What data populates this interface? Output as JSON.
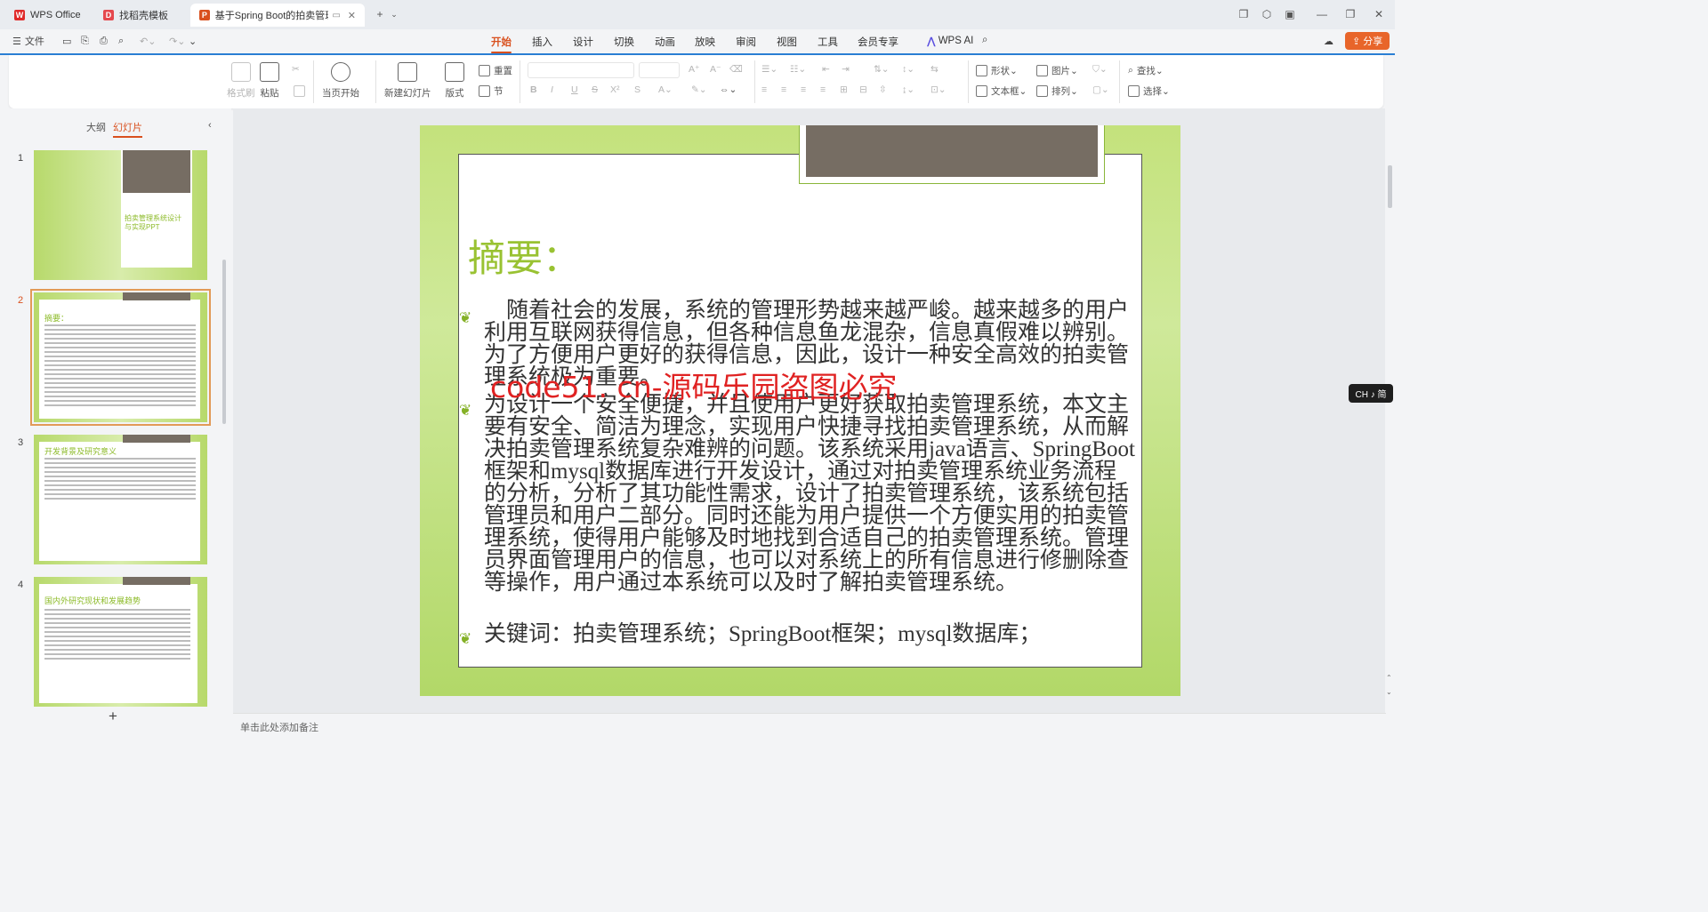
{
  "tabs": [
    {
      "label": "WPS Office",
      "logo": "W",
      "logo_color": "#e02a2a"
    },
    {
      "label": "找稻壳模板",
      "logo": "D",
      "logo_color": "#e5484d"
    },
    {
      "label": "基于Spring Boot的拍卖管理",
      "logo": "P",
      "logo_color": "#d9501e"
    }
  ],
  "menu": {
    "file_label": "文件",
    "tabs": [
      "开始",
      "插入",
      "设计",
      "切换",
      "动画",
      "放映",
      "审阅",
      "视图",
      "工具",
      "会员专享"
    ],
    "active_tab": "开始",
    "wps_ai": "WPS AI",
    "share": "分享"
  },
  "ribbon": {
    "format_painter": "格式刷",
    "paste": "粘贴",
    "current_start": "当页开始",
    "new_slide": "新建幻灯片",
    "layout": "版式",
    "reset": "重置",
    "section": "节",
    "font_size_a_up": "A⁺",
    "font_size_a_down": "A⁻",
    "bold": "B",
    "italic": "I",
    "underline": "U",
    "strike": "S",
    "superscript": "X²",
    "shape": "形状",
    "picture": "图片",
    "textbox": "文本框",
    "arrange": "排列",
    "find": "查找",
    "select": "选择"
  },
  "left_panel": {
    "tabs": [
      "大纲",
      "幻灯片"
    ],
    "active_tab": "幻灯片",
    "add_label": "+",
    "slides": [
      {
        "num": "1",
        "title": "拍卖管理系统设计与实现PPT"
      },
      {
        "num": "2",
        "title": "摘要："
      },
      {
        "num": "3",
        "title": "开发背景及研究意义"
      },
      {
        "num": "4",
        "title": "国内外研究现状和发展趋势"
      }
    ]
  },
  "slide": {
    "title": "摘要：",
    "bullets": [
      "　随着社会的发展，系统的管理形势越来越严峻。越来越多的用户利用互联网获得信息，但各种信息鱼龙混杂，信息真假难以辨别。为了方便用户更好的获得信息，因此，设计一种安全高效的拍卖管理系统极为重要。",
      "为设计一个安全便捷，并且使用户更好获取拍卖管理系统，本文主要有安全、简洁为理念，实现用户快捷寻找拍卖管理系统，从而解决拍卖管理系统复杂难辨的问题。该系统采用java语言、SpringBoot框架和mysql数据库进行开发设计，通过对拍卖管理系统业务流程的分析，分析了其功能性需求，设计了拍卖管理系统，该系统包括管理员和用户二部分。同时还能为用户提供一个方便实用的拍卖管理系统，使得用户能够及时地找到合适自己的拍卖管理系统。管理员界面管理用户的信息，也可以对系统上的所有信息进行修删除查等操作，用户通过本系统可以及时了解拍卖管理系统。",
      "关键词：拍卖管理系统；SpringBoot框架；mysql数据库；"
    ],
    "watermark": "code51. cn-源码乐园盗图必究"
  },
  "notes_placeholder": "单击此处添加备注",
  "ime_label": "CH ♪ 简",
  "colors": {
    "accent": "#d9501e",
    "title_green": "#99c232",
    "watermark_red": "#e02222"
  }
}
